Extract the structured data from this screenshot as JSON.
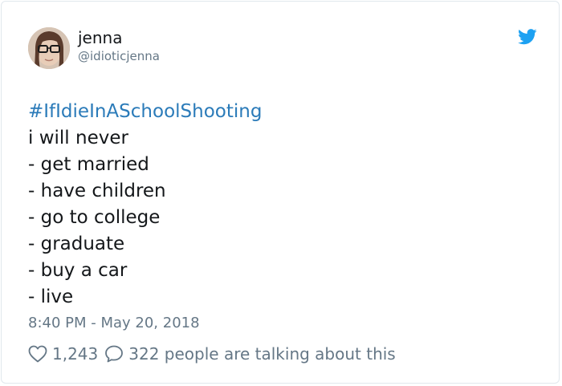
{
  "user": {
    "name": "jenna",
    "handle": "@idioticjenna"
  },
  "tweet": {
    "hashtag": "#IfIdieInASchoolShooting",
    "lines": [
      "i will never",
      "- get married",
      "- have children",
      "- go to college",
      "- graduate",
      "- buy a car",
      "- live"
    ]
  },
  "timestamp": "8:40 PM - May 20, 2018",
  "engagement": {
    "likes": "1,243",
    "talking": "322 people are talking about this"
  },
  "icons": {
    "brand": "twitter-bird-icon",
    "like": "heart-icon",
    "reply": "speech-bubble-icon"
  },
  "colors": {
    "brand": "#1da1f2",
    "link": "#2b7bb9",
    "text": "#14171a",
    "muted": "#657786",
    "border": "#e1e8ed"
  }
}
